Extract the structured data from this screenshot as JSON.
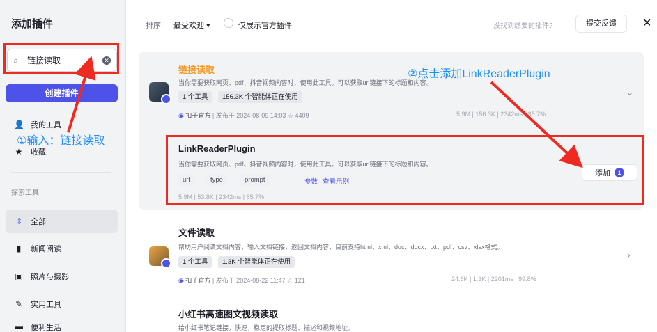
{
  "sidebar": {
    "title": "添加插件",
    "search_value": "链接读取",
    "create_label": "创建插件",
    "my_tools": "我的工具",
    "favorites": "收藏",
    "section_label": "探索工具",
    "categories": [
      "全部",
      "新闻阅读",
      "照片与摄影",
      "实用工具",
      "便利生活"
    ]
  },
  "topbar": {
    "sort_label": "排序:",
    "sort_value": "最受欢迎 ▾",
    "official_only": "仅展示官方插件",
    "not_found": "没找到想要的插件?",
    "feedback": "提交反馈",
    "close": "✕"
  },
  "plugins": [
    {
      "title": "链接读取",
      "desc": "当你需要获取网页、pdf、抖音视频内容时，使用此工具。可以获取url链接下的标题和内容。",
      "tags": [
        "1 个工具",
        "156.3K 个智能体正在使用"
      ],
      "publisher": "扣子官方",
      "published": "发布于 2024-08-09 14:03",
      "favorites": "4409",
      "stats": "5.9M  |  156.3K  |  2342ms  |  85.7%"
    },
    {
      "title": "文件读取",
      "desc": "帮助用户阅读文档内容，输入文档链接，返回文档内容，目前支持html、xml、doc、docx、txt、pdf、csv、xlsx格式。",
      "tags": [
        "1 个工具",
        "1.3K 个智能体正在使用"
      ],
      "publisher": "扣子官方",
      "published": "发布于 2024-08-22 11:47",
      "favorites": "121",
      "stats": "24.6K  |  1.3K  |  2201ms  |  99.8%"
    },
    {
      "title": "小红书高速图文视频读取",
      "desc": "给小红书笔记链接，快速，稳定的提取标题、描述和视频地址。"
    }
  ],
  "tool": {
    "name": "LinkReaderPlugin",
    "desc": "当你需要获取网页、pdf、抖音视频内容时，使用此工具。可以获取url链接下的标题和内容。",
    "params": [
      "url",
      "type",
      "prompt"
    ],
    "params_link": "参数",
    "example_link": "查看示例",
    "stats": "5.9M  |  53.8K  |  2342ms  |  85.7%",
    "add_label": "添加",
    "add_badge": "1"
  },
  "annotations": {
    "step1": "①输入：链接读取",
    "step2": "②点击添加LinkReaderPlugin"
  },
  "colors": {
    "accent": "#4d53e8",
    "annotation_red": "#ef2a20",
    "annotation_blue": "#1e90ff",
    "plugin_title_highlight": "#f49a26"
  }
}
